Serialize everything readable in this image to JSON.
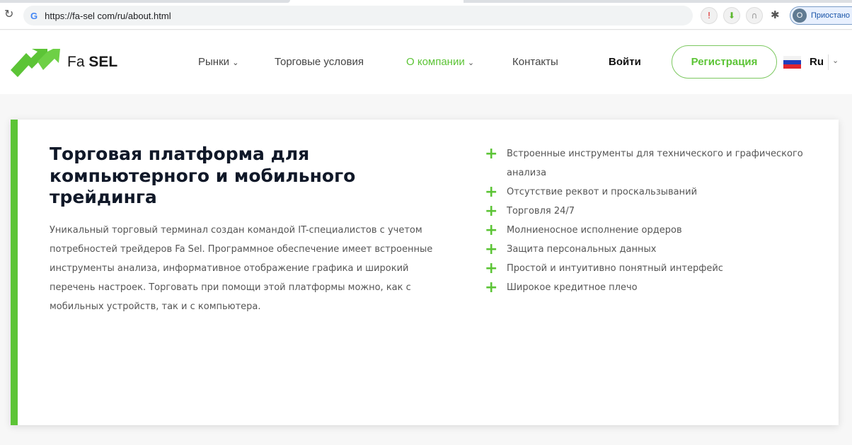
{
  "browser": {
    "url": "https://fa-sel com/ru/about.html",
    "profile_initial": "O",
    "profile_label": "Приостано",
    "extensions": [
      "pin-icon",
      "download-icon",
      "arch-icon",
      "puzzle-icon"
    ]
  },
  "header": {
    "brand_light": "Fa",
    "brand_bold": "SEL",
    "nav": [
      {
        "label": "Рынки",
        "chev": "⌄"
      },
      {
        "label": "Торговые условия"
      },
      {
        "label": "О компании",
        "chev": "⌄",
        "active": true
      },
      {
        "label": "Контакты"
      }
    ],
    "login": "Войти",
    "register": "Регистрация",
    "lang": "Ru",
    "accent": "#5cc436"
  },
  "main": {
    "title": "Торговая платформа для компьютерного и мобильного трейдинга",
    "description": "Уникальный торговый терминал создан командой IT-специалистов с учетом потребностей трейдеров Fa Sel. Программное обеспечение имеет встроенные инструменты анализа, информативное отображение графика и широкий перечень настроек. Торговать при помощи этой платформы можно, как с мобильных устройств, так и с компьютера.",
    "features": [
      "Встроенные инструменты для технического и графического анализа",
      "Отсутствие реквот и проскальзываний",
      "Торговля 24/7",
      "Молниеносное исполнение ордеров",
      "Защита персональных данных",
      "Простой и интуитивно понятный интерфейс",
      "Широкое кредитное плечо"
    ]
  }
}
